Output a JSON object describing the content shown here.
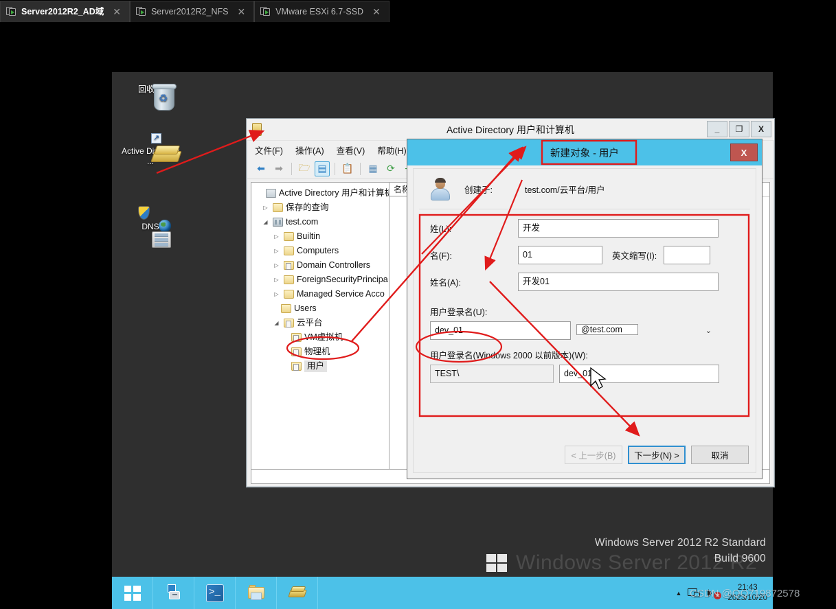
{
  "vm_tabs": [
    {
      "label": "Server2012R2_AD域",
      "active": true,
      "close": "✕"
    },
    {
      "label": "Server2012R2_NFS",
      "active": false,
      "close": "✕"
    },
    {
      "label": "VMware ESXi 6.7-SSD",
      "active": false,
      "close": "✕"
    }
  ],
  "desktop": {
    "icons": [
      {
        "label": "回收站",
        "name": "recycle-bin"
      },
      {
        "label": "Active Directory ...",
        "name": "active-directory-shortcut"
      },
      {
        "label": "DNS",
        "name": "dns-manager"
      }
    ],
    "branding_big": "Windows Server 2012 R2",
    "branding_line1": "Windows Server 2012 R2 Standard",
    "branding_line2": "Build 9600",
    "watermark": "CSDN @QQ719872578"
  },
  "taskbar": {
    "items": [
      {
        "name": "start-button",
        "icon": "windows-logo-icon"
      },
      {
        "name": "server-manager-button",
        "icon": "server-manager-icon"
      },
      {
        "name": "powershell-button",
        "icon": "powershell-icon"
      },
      {
        "name": "file-explorer-button",
        "icon": "file-explorer-icon"
      },
      {
        "name": "active-directory-button",
        "icon": "gold-bars-icon"
      }
    ],
    "tray": {
      "caret": "▲",
      "time": "21:43",
      "date": "2023/10/20"
    }
  },
  "ad_window": {
    "title": "Active Directory 用户和计算机",
    "window_buttons": {
      "minimize": "_",
      "maximize": "❐",
      "close": "X"
    },
    "menus": [
      "文件(F)",
      "操作(A)",
      "查看(V)",
      "帮助(H)"
    ],
    "toolbar_icons": [
      "back-arrow-icon",
      "forward-arrow-icon",
      "up-folder-icon",
      "show-tree-icon",
      "properties-icon",
      "list-view-icon",
      "refresh-icon",
      "export-icon"
    ],
    "list_columns": [
      "名称"
    ],
    "tree": [
      {
        "label": "Active Directory 用户和计算机",
        "indent": 0,
        "arrow": "",
        "icon": "root",
        "selected": false
      },
      {
        "label": "保存的查询",
        "indent": 1,
        "arrow": "▷",
        "icon": "folder",
        "selected": false
      },
      {
        "label": "test.com",
        "indent": 1,
        "arrow": "◢",
        "icon": "dom",
        "selected": false
      },
      {
        "label": "Builtin",
        "indent": 2,
        "arrow": "▷",
        "icon": "folder",
        "selected": false
      },
      {
        "label": "Computers",
        "indent": 2,
        "arrow": "▷",
        "icon": "folder",
        "selected": false
      },
      {
        "label": "Domain Controllers",
        "indent": 2,
        "arrow": "▷",
        "icon": "folder-ou",
        "selected": false
      },
      {
        "label": "ForeignSecurityPrincipa",
        "indent": 2,
        "arrow": "▷",
        "icon": "folder",
        "selected": false
      },
      {
        "label": "Managed Service Acco",
        "indent": 2,
        "arrow": "▷",
        "icon": "folder",
        "selected": false
      },
      {
        "label": "Users",
        "indent": 2,
        "arrow": "",
        "icon": "folder",
        "selected": false
      },
      {
        "label": "云平台",
        "indent": 2,
        "arrow": "◢",
        "icon": "folder-ou",
        "selected": false
      },
      {
        "label": "VM虚拟机",
        "indent": 3,
        "arrow": "",
        "icon": "folder-ou",
        "selected": false
      },
      {
        "label": "物理机",
        "indent": 3,
        "arrow": "",
        "icon": "folder-ou",
        "selected": false
      },
      {
        "label": "用户",
        "indent": 3,
        "arrow": "",
        "icon": "folder-ou",
        "selected": true
      }
    ],
    "hscroll": {
      "left_arrow": "‹",
      "right_arrow": "›",
      "thumb": "|||"
    }
  },
  "dialog": {
    "title": "新建对象 - 用户",
    "close_label": "X",
    "created_in_label": "创建于:",
    "created_in_value": "test.com/云平台/用户",
    "fields": {
      "last_name_label": "姓(L):",
      "last_name_value": "开发",
      "first_name_label": "名(F):",
      "first_name_value": "01",
      "initials_label": "英文缩写(I):",
      "initials_value": "",
      "full_name_label": "姓名(A):",
      "full_name_value": "开发01",
      "logon_name_label": "用户登录名(U):",
      "logon_name_value": "dev_01",
      "logon_suffix_value": "@test.com",
      "pre2000_label": "用户登录名(Windows 2000 以前版本)(W):",
      "pre2000_domain_value": "TEST\\",
      "pre2000_name_value": "dev_01"
    },
    "buttons": {
      "back": "< 上一步(B)",
      "next": "下一步(N) >",
      "cancel": "取消"
    }
  },
  "colors": {
    "accent_blue": "#4cc1e8",
    "annotation_red": "#e01b1b",
    "dialog_close_red": "#bf5650"
  }
}
